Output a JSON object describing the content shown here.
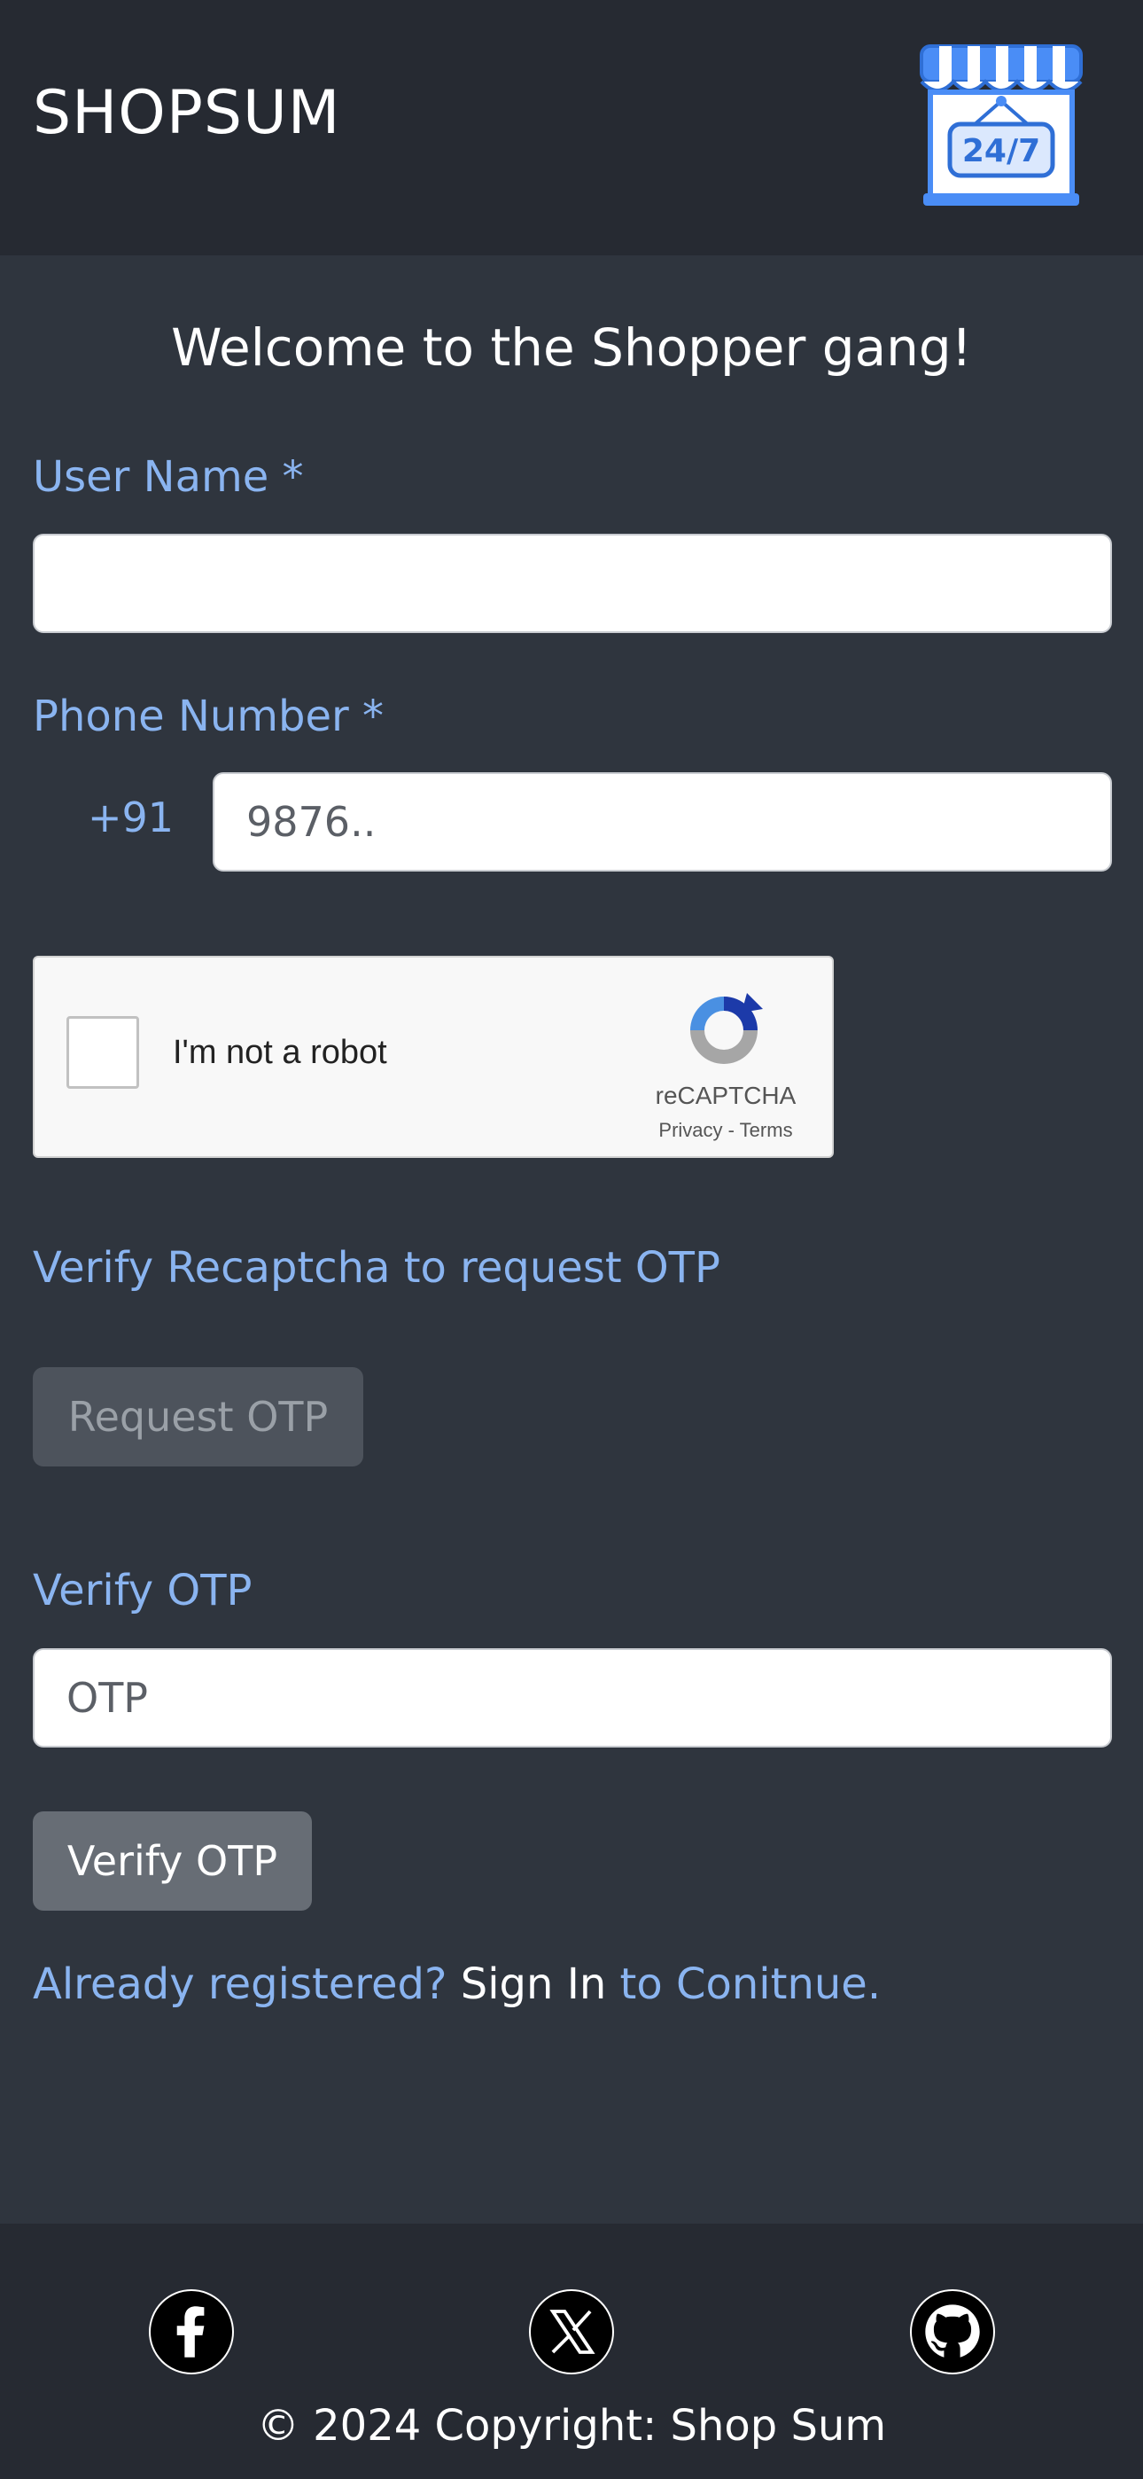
{
  "header": {
    "brand": "SHOPSUM",
    "logo_icon": "store-24-7-icon",
    "logo_text": "24/7"
  },
  "form": {
    "welcome": "Welcome to the Shopper gang!",
    "username_label": "User Name *",
    "username_value": "",
    "phone_label": "Phone Number *",
    "phone_prefix": "+91",
    "phone_placeholder": "9876..",
    "captcha": {
      "label": "I'm not a robot",
      "brand": "reCAPTCHA",
      "links": "Privacy - Terms"
    },
    "captcha_hint": "Verify Recaptcha to request OTP",
    "request_otp_button": "Request OTP",
    "verify_label": "Verify OTP",
    "otp_placeholder": "OTP",
    "verify_button": "Verify OTP",
    "signin_prefix": "Already registered?",
    "signin_link": "Sign In",
    "signin_suffix": "to Conitnue."
  },
  "footer": {
    "icons": [
      "facebook-icon",
      "x-twitter-icon",
      "github-icon"
    ],
    "copyright": "© 2024 Copyright: Shop Sum"
  },
  "colors": {
    "header_bg": "#262a32",
    "page_bg": "#2f353e",
    "accent": "#8ab4f0",
    "store_blue": "#4a8df6"
  }
}
